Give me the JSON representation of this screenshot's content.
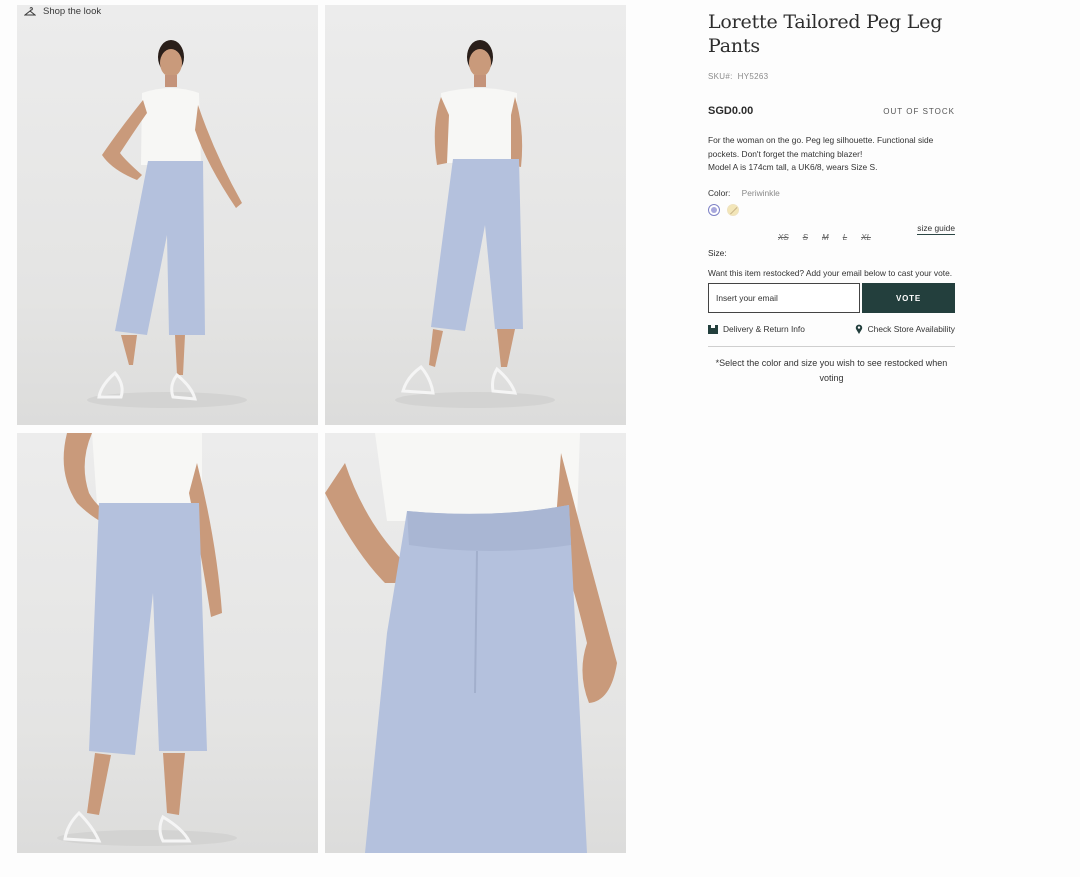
{
  "gallery": {
    "shop_the_look": "Shop the look",
    "images": [
      "hanger-icon"
    ]
  },
  "product": {
    "title": "Lorette Tailored Peg Leg Pants",
    "sku_label": "SKU#:",
    "sku_value": "HY5263",
    "price": "SGD0.00",
    "stock_status": "OUT OF STOCK",
    "description_line1": "For the woman on the go. Peg leg silhouette. Functional side pockets. Don't forget the matching blazer!",
    "description_line2": "Model A is 174cm tall, a UK6/8, wears Size S.",
    "color_label": "Color:",
    "color_value": "Periwinkle",
    "swatch_colors": [
      "#a8a8dd",
      "#f3e6b8"
    ],
    "size_label": "Size:",
    "size_guide": "size guide",
    "sizes": [
      "XS",
      "S",
      "M",
      "L",
      "XL"
    ]
  },
  "restock": {
    "prompt": "Want this item restocked? Add your email below to cast your vote.",
    "email_placeholder": "Insert your email",
    "vote_button": "VOTE",
    "note": "*Select the color and size you wish to see restocked when voting"
  },
  "links": {
    "delivery": "Delivery & Return Info",
    "store": "Check Store Availability"
  },
  "colors": {
    "accent": "#233f3d",
    "pants": "#b4c1dd"
  }
}
